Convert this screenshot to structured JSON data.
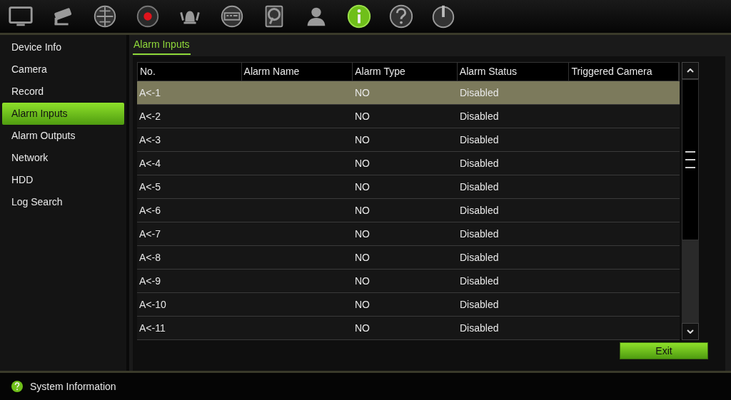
{
  "toolbar": [
    {
      "kind": "monitor",
      "selected": false
    },
    {
      "kind": "camera",
      "selected": false
    },
    {
      "kind": "network",
      "selected": false
    },
    {
      "kind": "record",
      "selected": false
    },
    {
      "kind": "alarm",
      "selected": false
    },
    {
      "kind": "device",
      "selected": false
    },
    {
      "kind": "hdd",
      "selected": false
    },
    {
      "kind": "user",
      "selected": false
    },
    {
      "kind": "info",
      "selected": true
    },
    {
      "kind": "help",
      "selected": false
    },
    {
      "kind": "power",
      "selected": false
    }
  ],
  "sidebar": {
    "items": [
      {
        "label": "Device Info",
        "selected": false
      },
      {
        "label": "Camera",
        "selected": false
      },
      {
        "label": "Record",
        "selected": false
      },
      {
        "label": "Alarm Inputs",
        "selected": true
      },
      {
        "label": "Alarm Outputs",
        "selected": false
      },
      {
        "label": "Network",
        "selected": false
      },
      {
        "label": "HDD",
        "selected": false
      },
      {
        "label": "Log Search",
        "selected": false
      }
    ]
  },
  "tabs": [
    {
      "label": "Alarm Inputs",
      "selected": true
    }
  ],
  "table": {
    "columns": [
      "No.",
      "Alarm Name",
      "Alarm Type",
      "Alarm Status",
      "Triggered Camera"
    ],
    "rows": [
      {
        "cells": [
          "A<-1",
          "",
          "NO",
          "Disabled",
          ""
        ],
        "selected": true
      },
      {
        "cells": [
          "A<-2",
          "",
          "NO",
          "Disabled",
          ""
        ],
        "selected": false
      },
      {
        "cells": [
          "A<-3",
          "",
          "NO",
          "Disabled",
          ""
        ],
        "selected": false
      },
      {
        "cells": [
          "A<-4",
          "",
          "NO",
          "Disabled",
          ""
        ],
        "selected": false
      },
      {
        "cells": [
          "A<-5",
          "",
          "NO",
          "Disabled",
          ""
        ],
        "selected": false
      },
      {
        "cells": [
          "A<-6",
          "",
          "NO",
          "Disabled",
          ""
        ],
        "selected": false
      },
      {
        "cells": [
          "A<-7",
          "",
          "NO",
          "Disabled",
          ""
        ],
        "selected": false
      },
      {
        "cells": [
          "A<-8",
          "",
          "NO",
          "Disabled",
          ""
        ],
        "selected": false
      },
      {
        "cells": [
          "A<-9",
          "",
          "NO",
          "Disabled",
          ""
        ],
        "selected": false
      },
      {
        "cells": [
          "A<-10",
          "",
          "NO",
          "Disabled",
          ""
        ],
        "selected": false
      },
      {
        "cells": [
          "A<-11",
          "",
          "NO",
          "Disabled",
          ""
        ],
        "selected": false
      }
    ]
  },
  "buttons": [
    "Exit"
  ],
  "status_bar": {
    "text": "System Information"
  }
}
